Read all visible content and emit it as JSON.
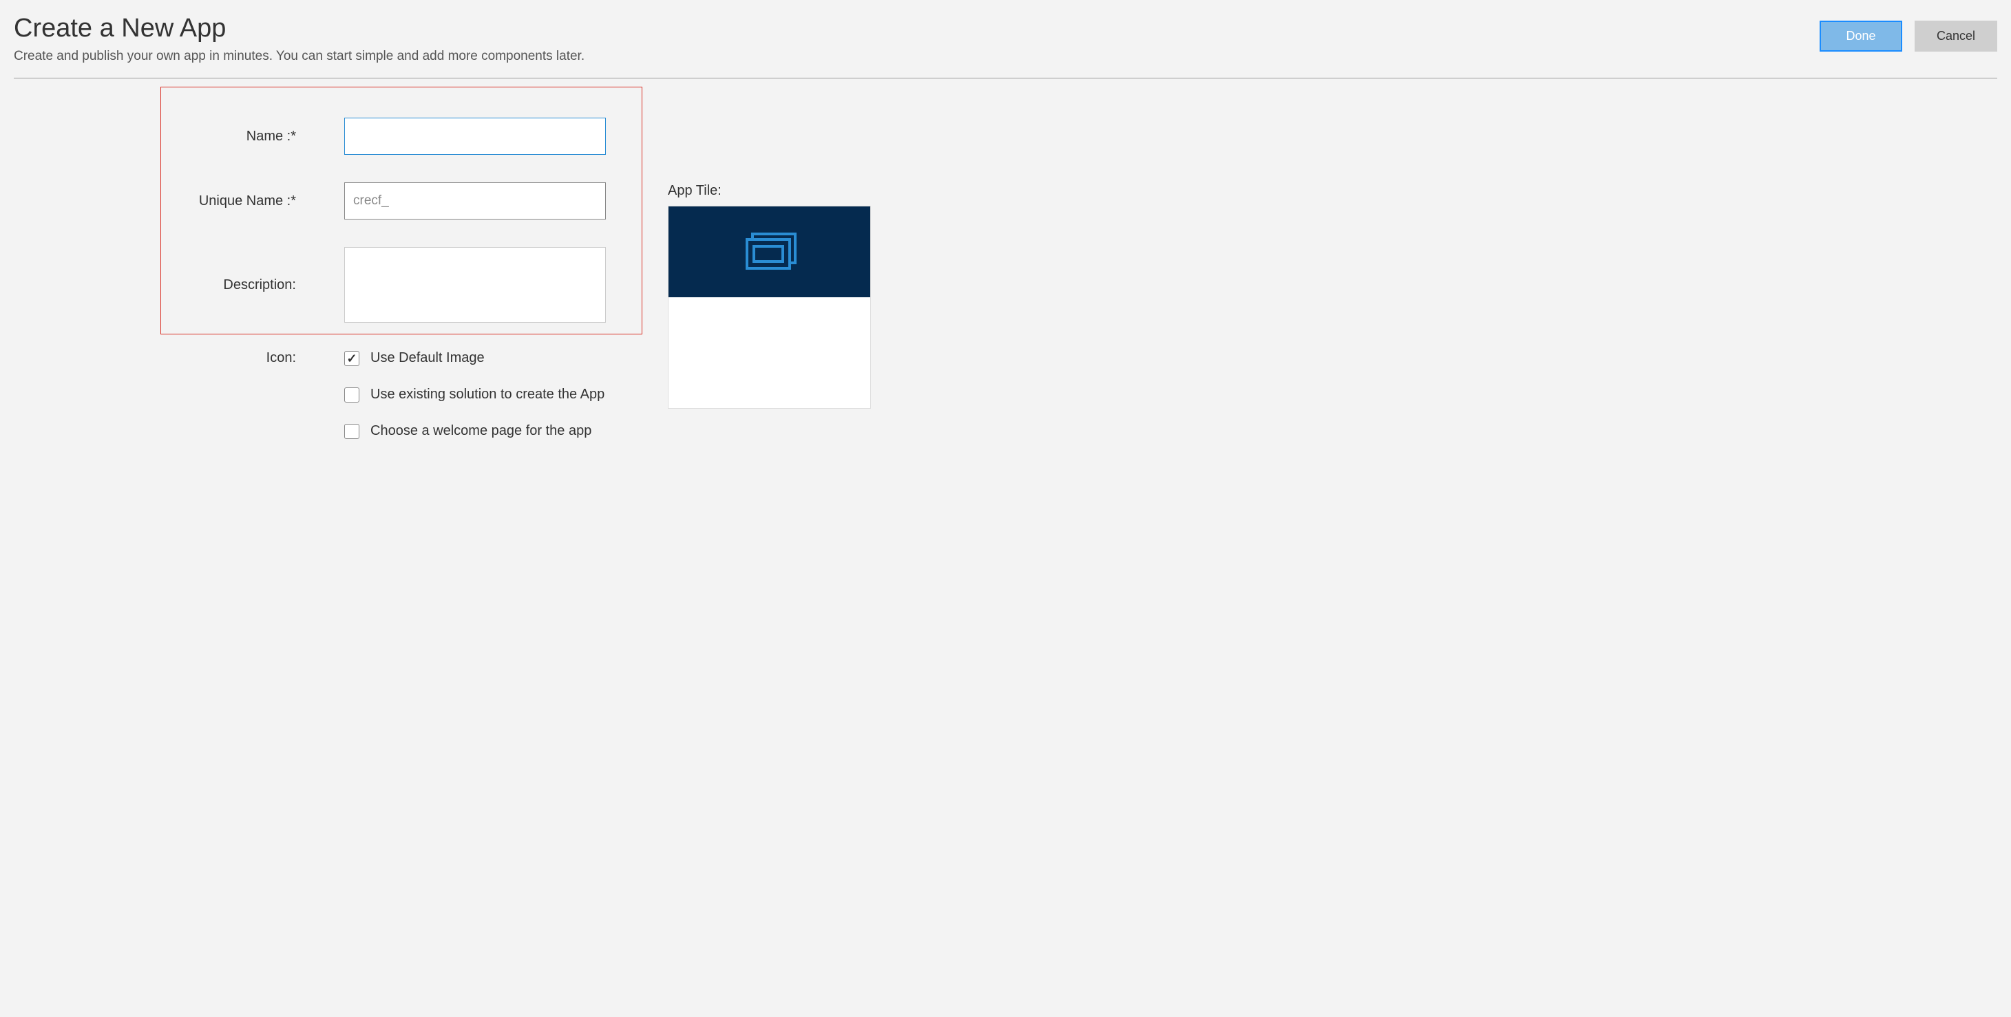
{
  "header": {
    "title": "Create a New App",
    "subtitle": "Create and publish your own app in minutes. You can start simple and add more components later.",
    "done_label": "Done",
    "cancel_label": "Cancel"
  },
  "form": {
    "name_label": "Name :*",
    "name_value": "",
    "unique_name_label": "Unique Name :*",
    "unique_name_value": "crecf_",
    "description_label": "Description:",
    "description_value": "",
    "icon_label": "Icon:",
    "use_default_image_label": "Use Default Image",
    "use_default_image_checked": true,
    "use_existing_solution_label": "Use existing solution to create the App",
    "use_existing_solution_checked": false,
    "choose_welcome_label": "Choose a welcome page for the app",
    "choose_welcome_checked": false
  },
  "preview": {
    "app_tile_label": "App Tile:"
  }
}
